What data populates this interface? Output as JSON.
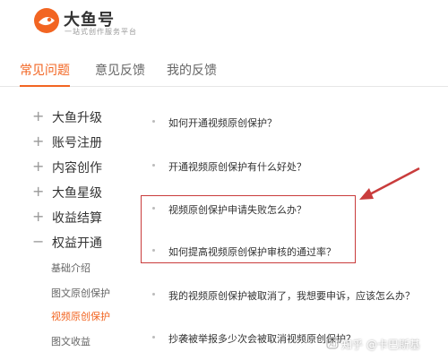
{
  "brand": {
    "name": "大鱼号",
    "tagline": "一站式创作服务平台",
    "accent": "#f26522"
  },
  "tabs": [
    {
      "label": "常见问题",
      "active": true
    },
    {
      "label": "意见反馈",
      "active": false
    },
    {
      "label": "我的反馈",
      "active": false
    }
  ],
  "sidebar": {
    "items": [
      {
        "symbol": "+",
        "label": "大鱼升级"
      },
      {
        "symbol": "+",
        "label": "账号注册"
      },
      {
        "symbol": "+",
        "label": "内容创作"
      },
      {
        "symbol": "+",
        "label": "大鱼星级"
      },
      {
        "symbol": "+",
        "label": "收益结算"
      },
      {
        "symbol": "−",
        "label": "权益开通"
      }
    ],
    "subitems": [
      {
        "label": "基础介绍",
        "active": false
      },
      {
        "label": "图文原创保护",
        "active": false
      },
      {
        "label": "视频原创保护",
        "active": true
      },
      {
        "label": "图文收益",
        "active": false
      }
    ]
  },
  "faq": [
    "如何开通视频原创保护？",
    "开通视频原创保护有什么好处？",
    "视频原创保护申请失败怎么办？",
    "如何提高视频原创保护审核的通过率？",
    "我的视频原创保护被取消了，我想要申诉，应该怎么办？",
    "抄袭被举报多少次会被取消视频原创保护？"
  ],
  "annotation": {
    "color": "#c93c3c"
  },
  "watermark": {
    "text": "知乎 @卡巴斯基"
  }
}
